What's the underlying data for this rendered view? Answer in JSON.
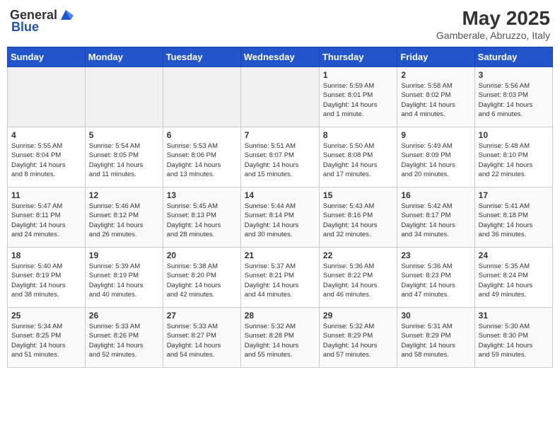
{
  "header": {
    "logo_general": "General",
    "logo_blue": "Blue",
    "month_year": "May 2025",
    "location": "Gamberale, Abruzzo, Italy"
  },
  "days_of_week": [
    "Sunday",
    "Monday",
    "Tuesday",
    "Wednesday",
    "Thursday",
    "Friday",
    "Saturday"
  ],
  "weeks": [
    [
      {
        "day": "",
        "info": ""
      },
      {
        "day": "",
        "info": ""
      },
      {
        "day": "",
        "info": ""
      },
      {
        "day": "",
        "info": ""
      },
      {
        "day": "1",
        "info": "Sunrise: 5:59 AM\nSunset: 8:01 PM\nDaylight: 14 hours\nand 1 minute."
      },
      {
        "day": "2",
        "info": "Sunrise: 5:58 AM\nSunset: 8:02 PM\nDaylight: 14 hours\nand 4 minutes."
      },
      {
        "day": "3",
        "info": "Sunrise: 5:56 AM\nSunset: 8:03 PM\nDaylight: 14 hours\nand 6 minutes."
      }
    ],
    [
      {
        "day": "4",
        "info": "Sunrise: 5:55 AM\nSunset: 8:04 PM\nDaylight: 14 hours\nand 8 minutes."
      },
      {
        "day": "5",
        "info": "Sunrise: 5:54 AM\nSunset: 8:05 PM\nDaylight: 14 hours\nand 11 minutes."
      },
      {
        "day": "6",
        "info": "Sunrise: 5:53 AM\nSunset: 8:06 PM\nDaylight: 14 hours\nand 13 minutes."
      },
      {
        "day": "7",
        "info": "Sunrise: 5:51 AM\nSunset: 8:07 PM\nDaylight: 14 hours\nand 15 minutes."
      },
      {
        "day": "8",
        "info": "Sunrise: 5:50 AM\nSunset: 8:08 PM\nDaylight: 14 hours\nand 17 minutes."
      },
      {
        "day": "9",
        "info": "Sunrise: 5:49 AM\nSunset: 8:09 PM\nDaylight: 14 hours\nand 20 minutes."
      },
      {
        "day": "10",
        "info": "Sunrise: 5:48 AM\nSunset: 8:10 PM\nDaylight: 14 hours\nand 22 minutes."
      }
    ],
    [
      {
        "day": "11",
        "info": "Sunrise: 5:47 AM\nSunset: 8:11 PM\nDaylight: 14 hours\nand 24 minutes."
      },
      {
        "day": "12",
        "info": "Sunrise: 5:46 AM\nSunset: 8:12 PM\nDaylight: 14 hours\nand 26 minutes."
      },
      {
        "day": "13",
        "info": "Sunrise: 5:45 AM\nSunset: 8:13 PM\nDaylight: 14 hours\nand 28 minutes."
      },
      {
        "day": "14",
        "info": "Sunrise: 5:44 AM\nSunset: 8:14 PM\nDaylight: 14 hours\nand 30 minutes."
      },
      {
        "day": "15",
        "info": "Sunrise: 5:43 AM\nSunset: 8:16 PM\nDaylight: 14 hours\nand 32 minutes."
      },
      {
        "day": "16",
        "info": "Sunrise: 5:42 AM\nSunset: 8:17 PM\nDaylight: 14 hours\nand 34 minutes."
      },
      {
        "day": "17",
        "info": "Sunrise: 5:41 AM\nSunset: 8:18 PM\nDaylight: 14 hours\nand 36 minutes."
      }
    ],
    [
      {
        "day": "18",
        "info": "Sunrise: 5:40 AM\nSunset: 8:19 PM\nDaylight: 14 hours\nand 38 minutes."
      },
      {
        "day": "19",
        "info": "Sunrise: 5:39 AM\nSunset: 8:19 PM\nDaylight: 14 hours\nand 40 minutes."
      },
      {
        "day": "20",
        "info": "Sunrise: 5:38 AM\nSunset: 8:20 PM\nDaylight: 14 hours\nand 42 minutes."
      },
      {
        "day": "21",
        "info": "Sunrise: 5:37 AM\nSunset: 8:21 PM\nDaylight: 14 hours\nand 44 minutes."
      },
      {
        "day": "22",
        "info": "Sunrise: 5:36 AM\nSunset: 8:22 PM\nDaylight: 14 hours\nand 46 minutes."
      },
      {
        "day": "23",
        "info": "Sunrise: 5:36 AM\nSunset: 8:23 PM\nDaylight: 14 hours\nand 47 minutes."
      },
      {
        "day": "24",
        "info": "Sunrise: 5:35 AM\nSunset: 8:24 PM\nDaylight: 14 hours\nand 49 minutes."
      }
    ],
    [
      {
        "day": "25",
        "info": "Sunrise: 5:34 AM\nSunset: 8:25 PM\nDaylight: 14 hours\nand 51 minutes."
      },
      {
        "day": "26",
        "info": "Sunrise: 5:33 AM\nSunset: 8:26 PM\nDaylight: 14 hours\nand 52 minutes."
      },
      {
        "day": "27",
        "info": "Sunrise: 5:33 AM\nSunset: 8:27 PM\nDaylight: 14 hours\nand 54 minutes."
      },
      {
        "day": "28",
        "info": "Sunrise: 5:32 AM\nSunset: 8:28 PM\nDaylight: 14 hours\nand 55 minutes."
      },
      {
        "day": "29",
        "info": "Sunrise: 5:32 AM\nSunset: 8:29 PM\nDaylight: 14 hours\nand 57 minutes."
      },
      {
        "day": "30",
        "info": "Sunrise: 5:31 AM\nSunset: 8:29 PM\nDaylight: 14 hours\nand 58 minutes."
      },
      {
        "day": "31",
        "info": "Sunrise: 5:30 AM\nSunset: 8:30 PM\nDaylight: 14 hours\nand 59 minutes."
      }
    ]
  ]
}
